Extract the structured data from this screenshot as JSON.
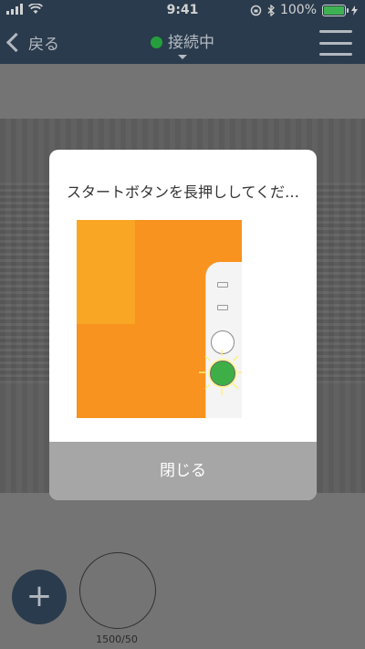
{
  "status_bar": {
    "time": "9:41",
    "battery": "100%",
    "battery_level": 1.0
  },
  "nav": {
    "back_label": "戻る",
    "connection_label": "接続中"
  },
  "modal": {
    "title": "スタートボタンを長押ししてくだ…",
    "close_label": "閉じる"
  },
  "bottom": {
    "add_label": "+",
    "counter": "1500/50"
  },
  "colors": {
    "navy": "#34485f",
    "orange": "#f7931e",
    "green": "#3eaf47",
    "close_gray": "#a6a6a6"
  }
}
